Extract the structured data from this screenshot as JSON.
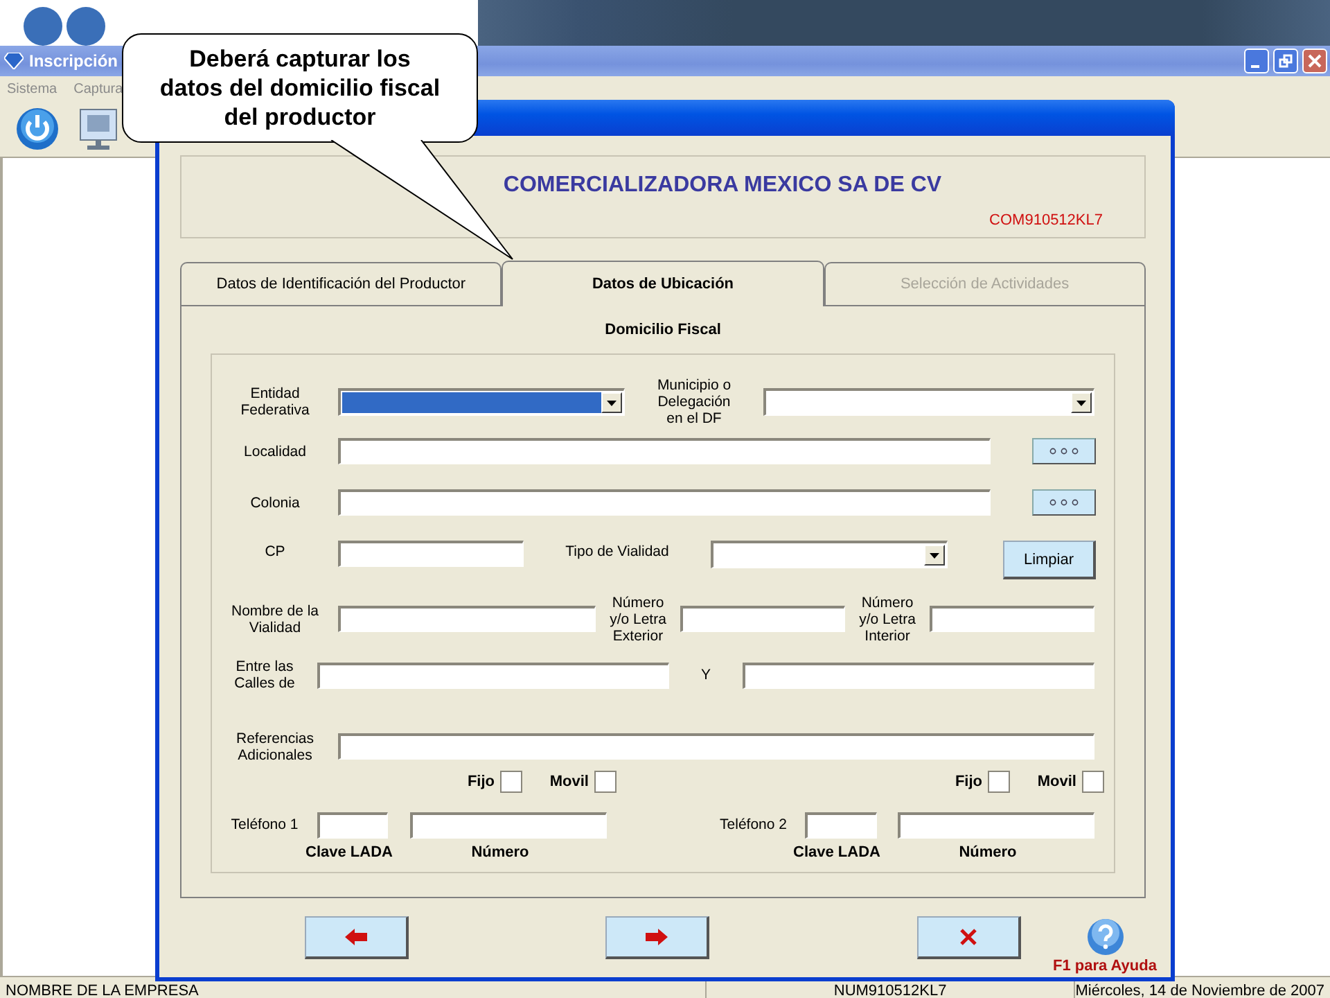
{
  "window": {
    "title": "Inscripción",
    "menu": [
      "Sistema",
      "Captura"
    ]
  },
  "callout": {
    "text": "Deberá capturar los datos del domicilio fiscal del productor"
  },
  "dialog": {
    "company": "COMERCIALIZADORA MEXICO SA DE CV",
    "rfc": "COM910512KL7",
    "tabs": [
      {
        "label": "Datos de Identificación del Productor",
        "selected": false,
        "disabled": false
      },
      {
        "label": "Datos de Ubicación",
        "selected": true,
        "disabled": false
      },
      {
        "label": "Selección de Actividades",
        "selected": false,
        "disabled": true
      }
    ],
    "section_title": "Domicilio Fiscal",
    "form_lines": [
      {
        "items": [
          {
            "kind": "label",
            "text": "Entidad\nFederativa"
          },
          {
            "kind": "select",
            "highlighted": true
          },
          {
            "kind": "label",
            "text": "Municipio o\nDelegación\nen el DF"
          },
          {
            "kind": "select",
            "highlighted": false
          }
        ]
      },
      {
        "items": [
          {
            "kind": "label",
            "text": "Localidad"
          },
          {
            "kind": "input"
          },
          {
            "kind": "browse"
          }
        ]
      },
      {
        "items": [
          {
            "kind": "label",
            "text": "Colonia"
          },
          {
            "kind": "input"
          },
          {
            "kind": "browse"
          }
        ]
      },
      {
        "items": [
          {
            "kind": "label",
            "text": "CP"
          },
          {
            "kind": "input"
          },
          {
            "kind": "label",
            "text": "Tipo de Vialidad"
          },
          {
            "kind": "select",
            "highlighted": false
          },
          {
            "kind": "button",
            "text": "Limpiar"
          }
        ]
      },
      {
        "items": [
          {
            "kind": "label",
            "text": "Nombre de la\nVialidad"
          },
          {
            "kind": "input"
          },
          {
            "kind": "label",
            "text": "Número\ny/o Letra\nExterior"
          },
          {
            "kind": "input"
          },
          {
            "kind": "label",
            "text": "Número\ny/o Letra\nInterior"
          },
          {
            "kind": "input"
          }
        ]
      },
      {
        "items": [
          {
            "kind": "label",
            "text": "Entre las\nCalles de"
          },
          {
            "kind": "input"
          },
          {
            "kind": "label",
            "text": "Y"
          },
          {
            "kind": "input"
          }
        ]
      },
      {
        "items": [
          {
            "kind": "label",
            "text": "Referencias\nAdicionales"
          },
          {
            "kind": "input"
          }
        ]
      },
      {
        "items": [
          {
            "kind": "caption",
            "text": "Fijo"
          },
          {
            "kind": "checkbox",
            "checked": false
          },
          {
            "kind": "caption",
            "text": "Movil"
          },
          {
            "kind": "checkbox",
            "checked": false
          },
          {
            "kind": "caption",
            "text": "Fijo"
          },
          {
            "kind": "checkbox",
            "checked": false
          },
          {
            "kind": "caption",
            "text": "Movil"
          },
          {
            "kind": "checkbox",
            "checked": false
          }
        ]
      },
      {
        "items": [
          {
            "kind": "label",
            "text": "Teléfono 1"
          },
          {
            "kind": "input"
          },
          {
            "kind": "input"
          },
          {
            "kind": "label",
            "text": "Teléfono 2"
          },
          {
            "kind": "input"
          },
          {
            "kind": "input"
          }
        ]
      },
      {
        "items": [
          {
            "kind": "caption",
            "text": "Clave LADA"
          },
          {
            "kind": "caption",
            "text": "Número"
          },
          {
            "kind": "caption",
            "text": "Clave LADA"
          },
          {
            "kind": "caption",
            "text": "Número"
          }
        ]
      }
    ],
    "nav_buttons": [
      {
        "kind": "back"
      },
      {
        "kind": "next"
      },
      {
        "kind": "cancel"
      }
    ],
    "help": "F1 para Ayuda"
  },
  "status_bar": [
    "NOMBRE DE LA EMPRESA",
    "NUM910512KL7",
    "Miércoles, 14 de Noviembre de 2007"
  ]
}
